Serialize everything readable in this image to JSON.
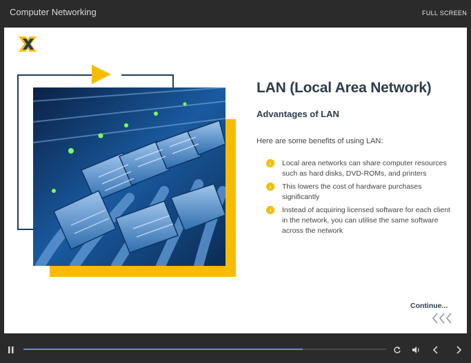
{
  "header": {
    "course_title": "Computer Networking",
    "fullscreen_label": "FULL SCREEN"
  },
  "slide": {
    "title": "LAN (Local Area Network)",
    "subtitle": "Advantages of LAN",
    "intro": "Here are some benefits of using LAN:",
    "benefits": [
      "Local area networks can share computer resources such as hard disks, DVD-ROMs, and printers",
      "This lowers the cost of hardware purchases significantly",
      "Instead of acquiring licensed software for each client in the network, you can utilise the same software across the network"
    ],
    "continue_label": "Continue..."
  },
  "player": {
    "progress_fraction": 0.77,
    "controls": {
      "play_pause": "pause-icon",
      "replay": "replay-icon",
      "volume": "volume-icon",
      "previous": "chevron-left-icon",
      "next": "chevron-right-icon"
    }
  },
  "colors": {
    "accent_yellow": "#f6bd00",
    "frame_navy": "#1e3c5c",
    "title_text": "#2e3b4a",
    "progress_blue": "#6d8fc7",
    "chrome_dark": "#2b2b2b"
  }
}
